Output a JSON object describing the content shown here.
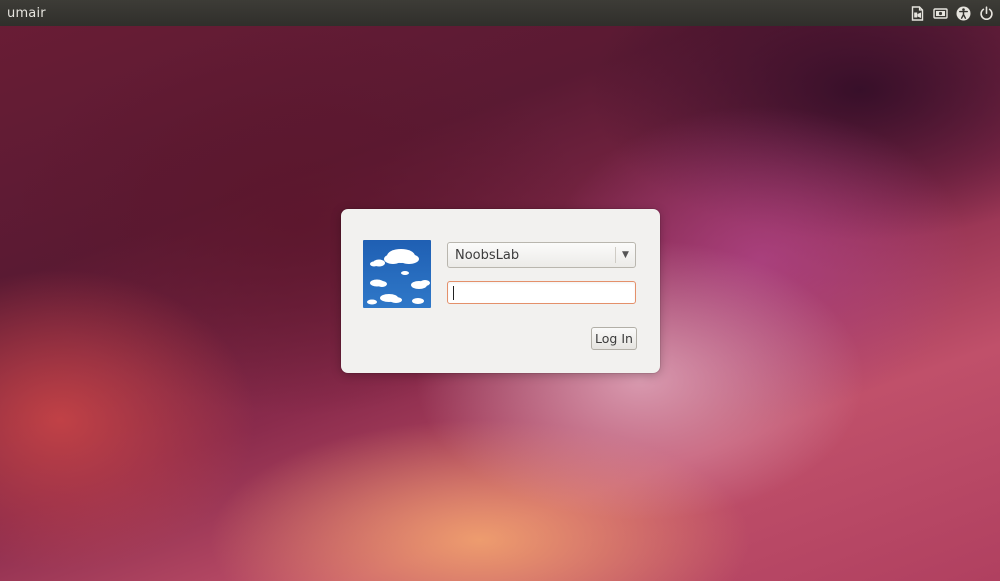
{
  "topbar": {
    "hostname": "umair",
    "indicators": [
      {
        "icon": "keyboard-layout-icon"
      },
      {
        "icon": "session-icon"
      },
      {
        "icon": "accessibility-icon"
      },
      {
        "icon": "power-icon"
      }
    ]
  },
  "login": {
    "avatar_icon": "user-avatar-clouds",
    "selected_user": "NoobsLab",
    "password_value": "",
    "login_label": "Log In"
  },
  "colors": {
    "topbar_bg": "#3d3c37",
    "dialog_bg": "#f2f1ef",
    "focus_border": "#e4906a"
  }
}
